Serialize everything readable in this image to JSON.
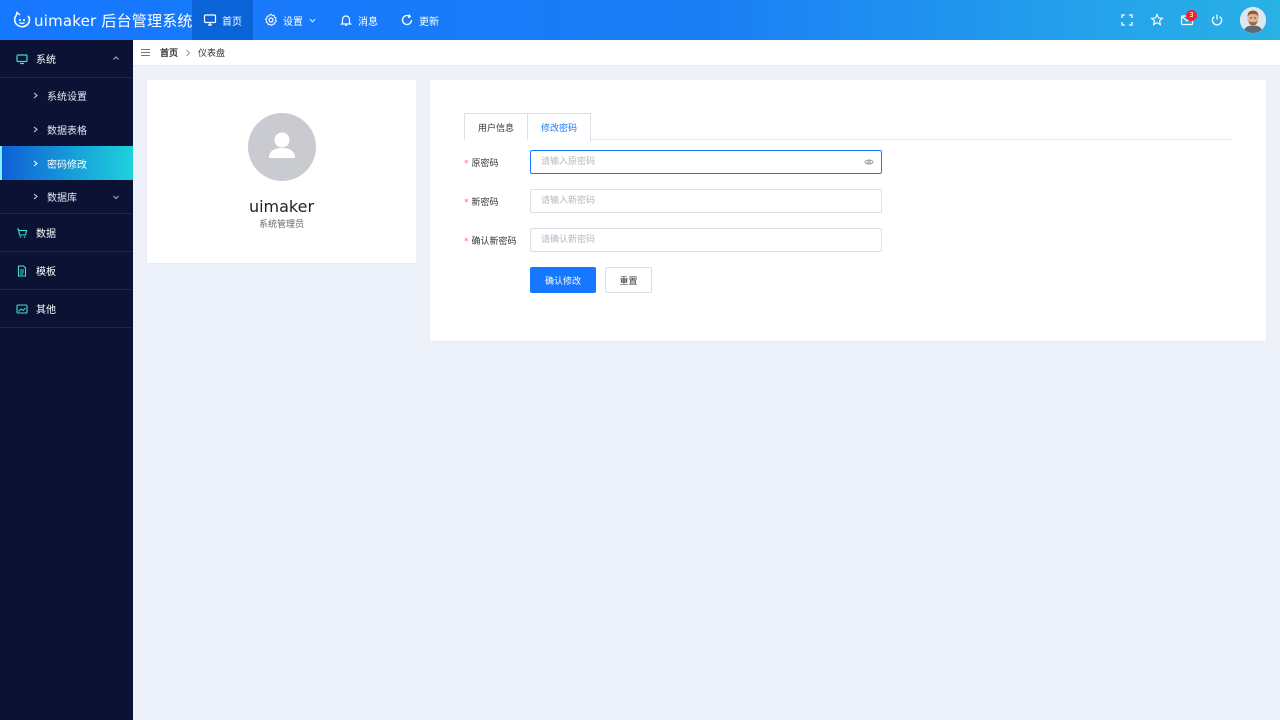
{
  "app": {
    "logo_text": "uimaker 后台管理系统",
    "brand_color": "#1677ff",
    "accent_gradient": [
      "#0f60d6",
      "#1fd1dc"
    ]
  },
  "topnav": {
    "items": [
      {
        "label": "首页",
        "icon": "monitor-icon",
        "active": true
      },
      {
        "label": "设置",
        "icon": "gear-icon",
        "has_dropdown": true
      },
      {
        "label": "消息",
        "icon": "bell-icon"
      },
      {
        "label": "更新",
        "icon": "refresh-icon"
      }
    ],
    "right_icons": [
      "fullscreen-icon",
      "star-icon",
      "mail-icon",
      "power-icon"
    ],
    "mail_badge": "3"
  },
  "sidebar": {
    "groups": [
      {
        "label": "系统",
        "icon": "monitor-icon",
        "expanded": true,
        "children": [
          {
            "label": "系统设置"
          },
          {
            "label": "数据表格"
          },
          {
            "label": "密码修改",
            "active": true
          },
          {
            "label": "数据库",
            "has_children": true
          }
        ]
      },
      {
        "label": "数据",
        "icon": "cart-icon"
      },
      {
        "label": "模板",
        "icon": "document-icon"
      },
      {
        "label": "其他",
        "icon": "image-icon"
      }
    ]
  },
  "breadcrumb": {
    "home": "首页",
    "current": "仪表盘"
  },
  "profile": {
    "name": "uimaker",
    "role": "系统管理员"
  },
  "form": {
    "tabs": [
      {
        "label": "用户信息"
      },
      {
        "label": "修改密码",
        "active": true
      }
    ],
    "fields": [
      {
        "label": "原密码",
        "placeholder": "请输入原密码",
        "required": true
      },
      {
        "label": "新密码",
        "placeholder": "请输入新密码",
        "required": true
      },
      {
        "label": "确认新密码",
        "placeholder": "请确认新密码",
        "required": true
      }
    ],
    "required_mark": "*",
    "submit_label": "确认修改",
    "reset_label": "重置"
  }
}
